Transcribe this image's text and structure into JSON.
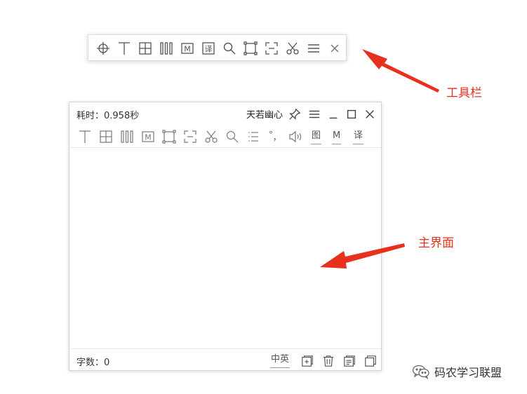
{
  "toolbar": {
    "icons": [
      "crosshair-icon",
      "text-icon",
      "grid-icon",
      "columns-icon",
      "m-icon",
      "translate-icon",
      "search-icon",
      "fullscreen-icon",
      "region-icon",
      "scissors-icon",
      "menu-icon",
      "close-icon"
    ],
    "m_glyph": "M",
    "translate_glyph": "译"
  },
  "window": {
    "elapsed": "耗时：0.958秒",
    "username": "天若幽心",
    "row2": {
      "m_glyph": "M",
      "degree_glyph": "°",
      "comma_glyph": "，",
      "image_label": "图",
      "m_label": "M",
      "translate_label": "译"
    },
    "char_count": "字数：0",
    "lang_toggle": "中英"
  },
  "annotations": {
    "toolbar_label": "工具栏",
    "main_label": "主界面",
    "arrow_color": "#e8301e"
  },
  "watermark": {
    "text": "码农学习联盟"
  }
}
